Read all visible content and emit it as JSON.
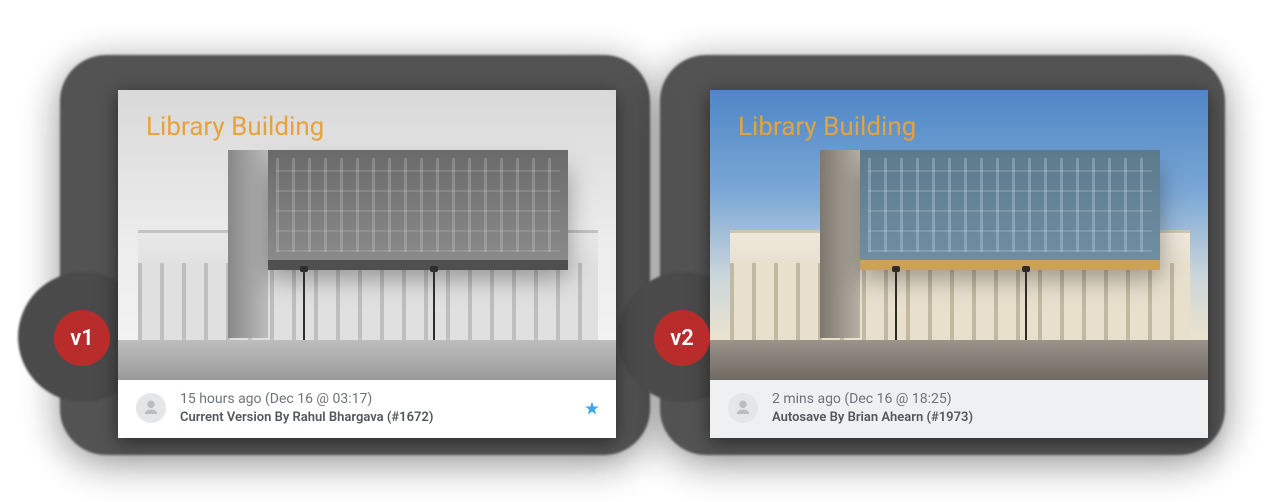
{
  "versions": [
    {
      "badge": "v1",
      "title": "Library Building",
      "meta_line1": "15 hours ago (Dec 16 @ 03:17)",
      "meta_line2": "Current Version By Rahul Bhargava (#1672)",
      "starred": true,
      "meta_bg": "white",
      "grayscale": true
    },
    {
      "badge": "v2",
      "title": "Library Building",
      "meta_line1": "2 mins ago (Dec 16 @ 18:25)",
      "meta_line2": "Autosave By Brian Ahearn (#1973)",
      "starred": false,
      "meta_bg": "grey",
      "grayscale": false
    }
  ],
  "colors": {
    "badge_bg": "#b92c2c",
    "title": "#e8a23a",
    "star": "#3ba7ea"
  }
}
